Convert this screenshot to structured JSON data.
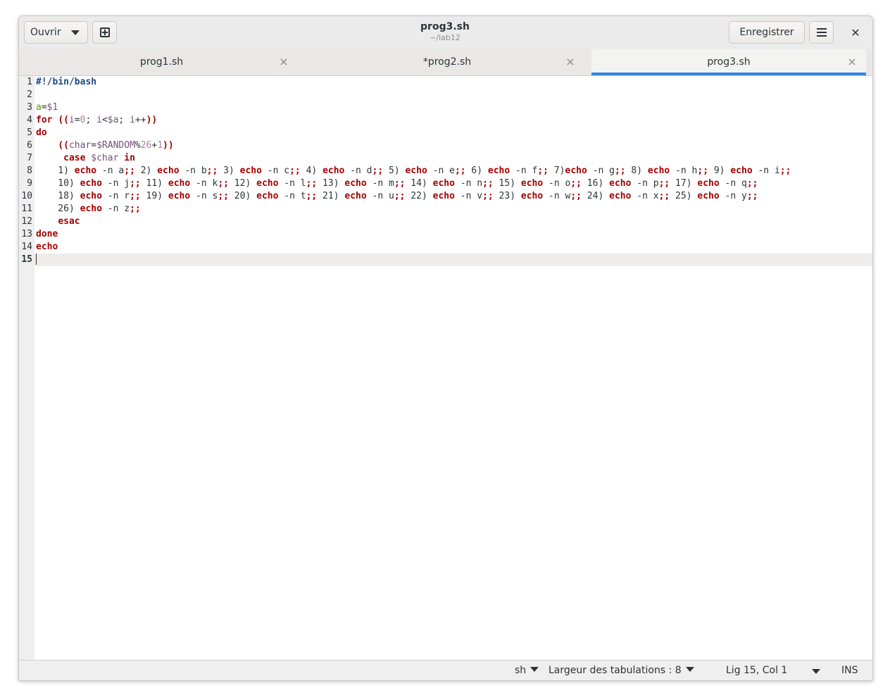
{
  "header": {
    "open_label": "Ouvrir",
    "title": "prog3.sh",
    "subtitle": "~/lab12",
    "save_label": "Enregistrer",
    "close_glyph": "✕"
  },
  "tabs": [
    {
      "label": "prog1.sh",
      "close": "×",
      "active": false
    },
    {
      "label": "*prog2.sh",
      "close": "×",
      "active": false
    },
    {
      "label": "prog3.sh",
      "close": "×",
      "active": true
    }
  ],
  "editor": {
    "line_numbers": [
      "1",
      "2",
      "3",
      "4",
      "5",
      "6",
      "7",
      "8",
      "9",
      "10",
      "11",
      "12",
      "13",
      "14",
      "15"
    ],
    "current_line": "15",
    "lines": [
      "#!/bin/bash",
      "",
      "a=$1",
      "for ((i=0; i<$a; i++))",
      "do",
      "    ((char=$RANDOM%26+1))",
      "     case $char in",
      "    1) echo -n a;; 2) echo -n b;; 3) echo -n c;; 4) echo -n d;; 5) echo -n e;; 6) echo -n f;; 7)echo -n g;; 8) echo -n h;; 9) echo -n i;;",
      "    10) echo -n j;; 11) echo -n k;; 12) echo -n l;; 13) echo -n m;; 14) echo -n n;; 15) echo -n o;; 16) echo -n p;; 17) echo -n q;;",
      "    18) echo -n r;; 19) echo -n s;; 20) echo -n t;; 21) echo -n u;; 22) echo -n v;; 23) echo -n w;; 24) echo -n x;; 25) echo -n y;;",
      "    26) echo -n z;;",
      "    esac",
      "done",
      "echo",
      ""
    ]
  },
  "statusbar": {
    "language": "sh",
    "tab_width": "Largeur des tabulations : 8",
    "position": "Lig 15, Col 1",
    "mode": "INS"
  },
  "colors": {
    "keyword": "#a40000",
    "shebang": "#204a87",
    "variable": "#75507b",
    "number": "#ad7fa8",
    "accent": "#3584e4"
  }
}
